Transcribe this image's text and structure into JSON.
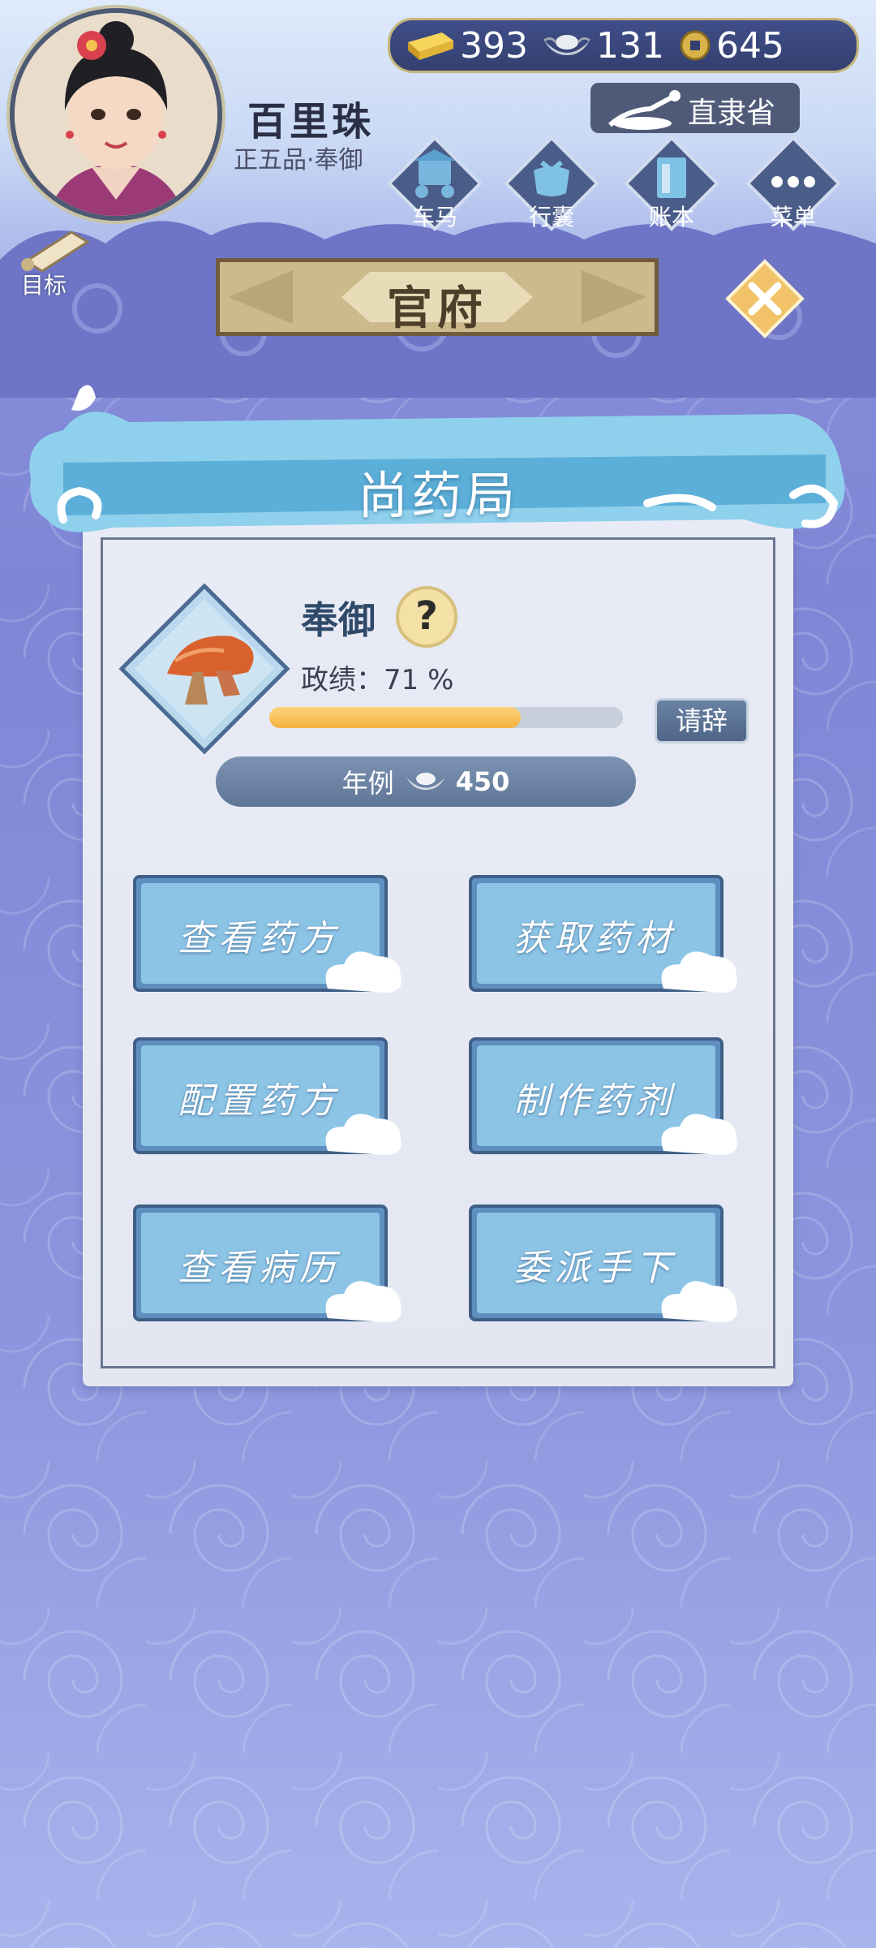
{
  "profile": {
    "name": "百里珠",
    "rank": "正五品·奉御"
  },
  "currency": {
    "gold": "393",
    "silver": "131",
    "coin": "645"
  },
  "location": {
    "label": "直隶省"
  },
  "nav": [
    {
      "label": "车马",
      "icon": "carriage-icon"
    },
    {
      "label": "行囊",
      "icon": "bag-icon"
    },
    {
      "label": "账本",
      "icon": "ledger-icon"
    },
    {
      "label": "菜单",
      "icon": "menu-dots-icon"
    }
  ],
  "goal": {
    "label": "目标"
  },
  "office": {
    "title": "官府"
  },
  "bureau": {
    "name": "尚药局"
  },
  "job": {
    "title": "奉御",
    "help": "?",
    "merit_text": "政绩：71 %",
    "merit_progress": 0.71,
    "resign_label": "请辞",
    "salary_label": "年例",
    "salary_value": "450"
  },
  "actions": [
    {
      "label": "查看药方"
    },
    {
      "label": "获取药材"
    },
    {
      "label": "配置药方"
    },
    {
      "label": "制作药剂"
    },
    {
      "label": "查看病历"
    },
    {
      "label": "委派手下"
    }
  ],
  "colors": {
    "accent": "#f4b23c",
    "panel": "#e8ebf5",
    "button": "#4e6588"
  }
}
